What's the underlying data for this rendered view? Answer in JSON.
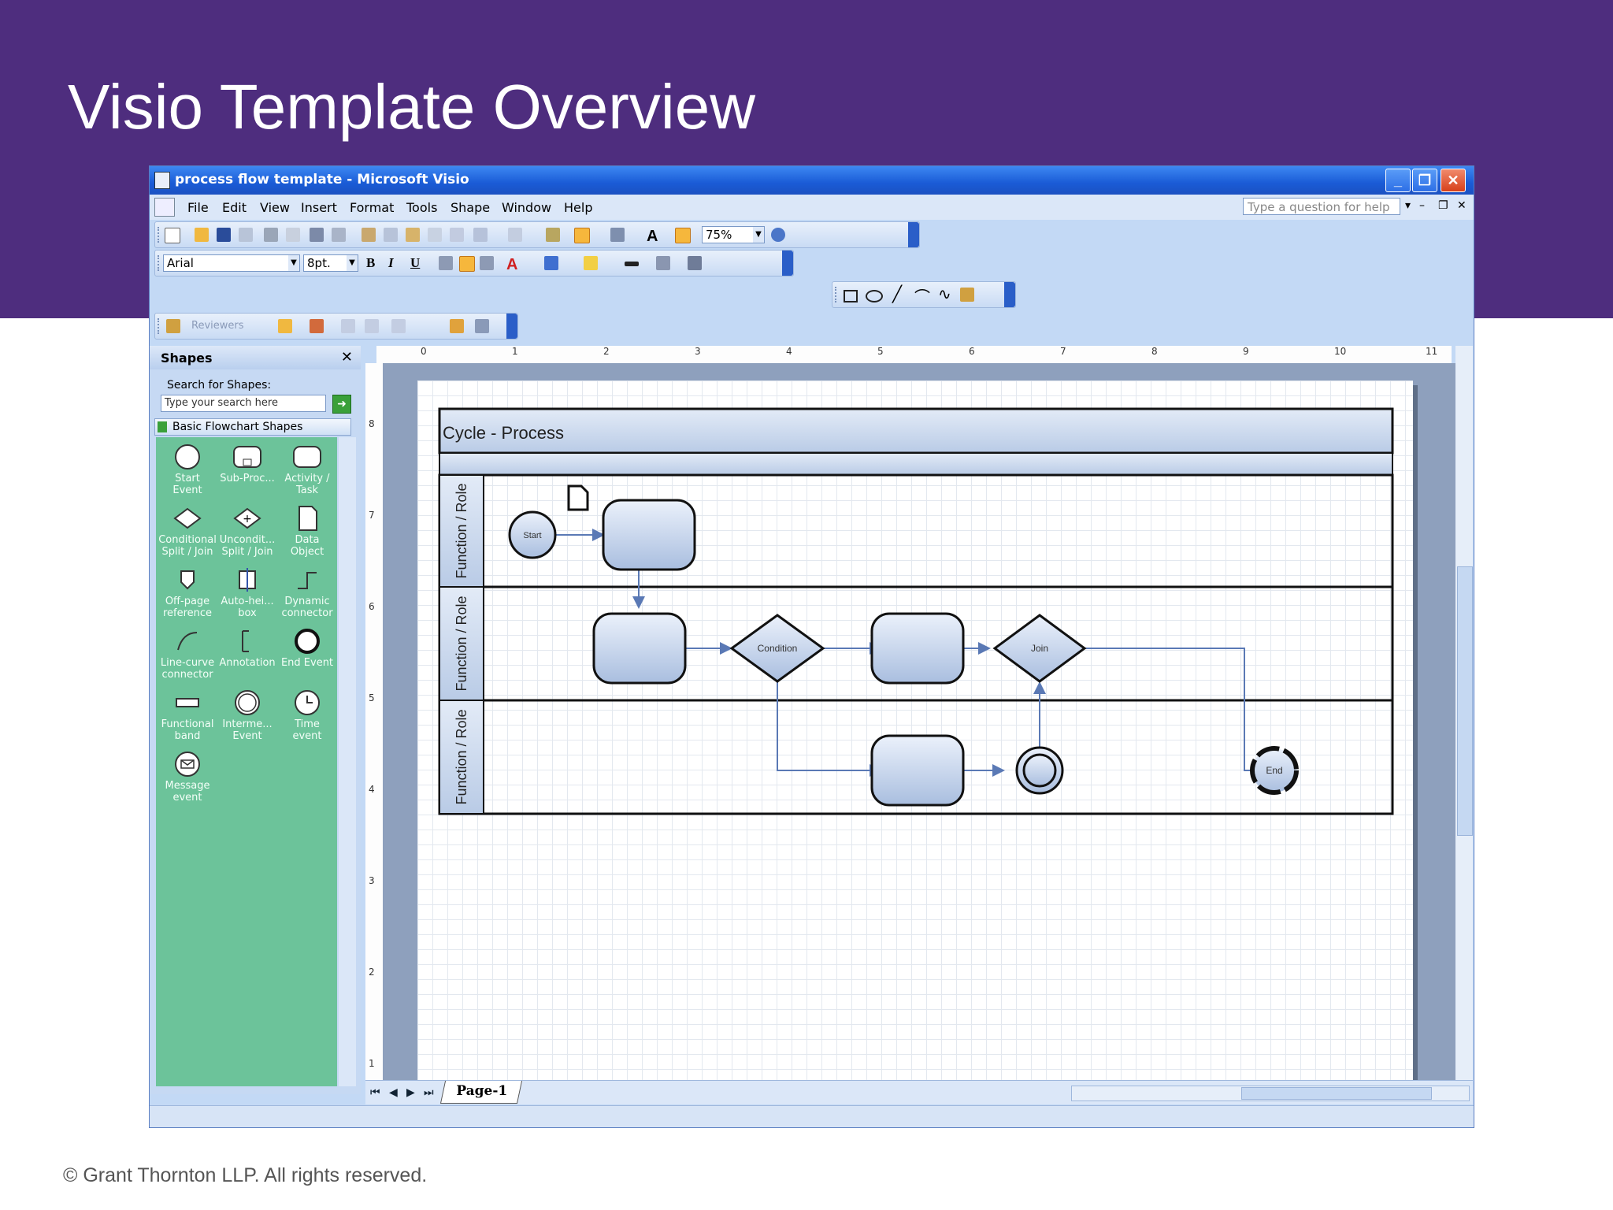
{
  "slide": {
    "title": "Visio Template Overview",
    "footer": "© Grant Thornton LLP. All rights reserved."
  },
  "window": {
    "title": "process flow template - Microsoft Visio",
    "help_placeholder": "Type a question for help"
  },
  "menu": [
    "File",
    "Edit",
    "View",
    "Insert",
    "Format",
    "Tools",
    "Shape",
    "Window",
    "Help"
  ],
  "toolbar": {
    "zoom": "75%",
    "font": "Arial",
    "font_size": "8pt.",
    "bold": "B",
    "italic": "I",
    "underline": "U",
    "font_color_glyph": "A",
    "reviewers": "Reviewers"
  },
  "shapes_pane": {
    "title": "Shapes",
    "search_label": "Search for Shapes:",
    "search_placeholder": "Type your search here",
    "stencil_name": "Basic Flowchart Shapes",
    "masters": [
      {
        "line1": "Start",
        "line2": "Event"
      },
      {
        "line1": "Sub-Proc...",
        "line2": ""
      },
      {
        "line1": "Activity /",
        "line2": "Task"
      },
      {
        "line1": "Conditional",
        "line2": "Split / Join"
      },
      {
        "line1": "Uncondit...",
        "line2": "Split / Join"
      },
      {
        "line1": "Data",
        "line2": "Object"
      },
      {
        "line1": "Off-page",
        "line2": "reference"
      },
      {
        "line1": "Auto-hei...",
        "line2": "box"
      },
      {
        "line1": "Dynamic",
        "line2": "connector"
      },
      {
        "line1": "Line-curve",
        "line2": "connector"
      },
      {
        "line1": "Annotation",
        "line2": ""
      },
      {
        "line1": "End Event",
        "line2": ""
      },
      {
        "line1": "Functional",
        "line2": "band"
      },
      {
        "line1": "Interme...",
        "line2": "Event"
      },
      {
        "line1": "Time",
        "line2": "event"
      },
      {
        "line1": "Message",
        "line2": "event"
      }
    ]
  },
  "rulers": {
    "horizontal": [
      "0",
      "1",
      "2",
      "3",
      "4",
      "5",
      "6",
      "7",
      "8",
      "9",
      "10",
      "11"
    ],
    "vertical": [
      "8",
      "7",
      "6",
      "5",
      "4",
      "3",
      "2",
      "1"
    ]
  },
  "diagram": {
    "title": "Cycle - Process",
    "lane_label": "Function / Role",
    "start_label": "Start",
    "condition_label": "Condition",
    "join_label": "Join",
    "end_label": "End"
  },
  "page_tab": "Page-1"
}
